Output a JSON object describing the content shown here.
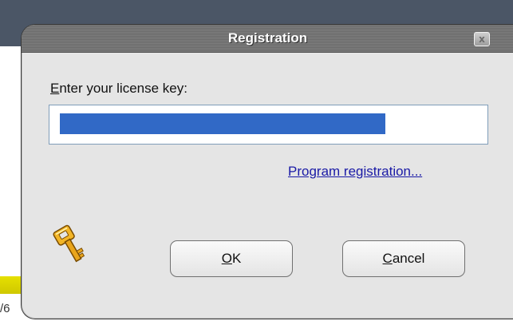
{
  "dialog": {
    "title": "Registration",
    "close_glyph": "x",
    "prompt": {
      "accelerator": "E",
      "rest": "nter your license key:"
    },
    "license_key_value": "",
    "registration_link": "Program registration...",
    "ok_button": {
      "accelerator": "O",
      "rest": "K"
    },
    "cancel_button": {
      "accelerator": "C",
      "rest": "ancel"
    },
    "icon": "key-icon"
  },
  "background": {
    "fragment_text": "/6"
  },
  "colors": {
    "titlebar": "#6f6f6f",
    "dialog_body": "#e5e5e5",
    "selection": "#3169c6",
    "link": "#1a1aa6",
    "background_top": "#4b5666",
    "background_bar": "#dcd500",
    "key_icon": "#f0b020"
  }
}
